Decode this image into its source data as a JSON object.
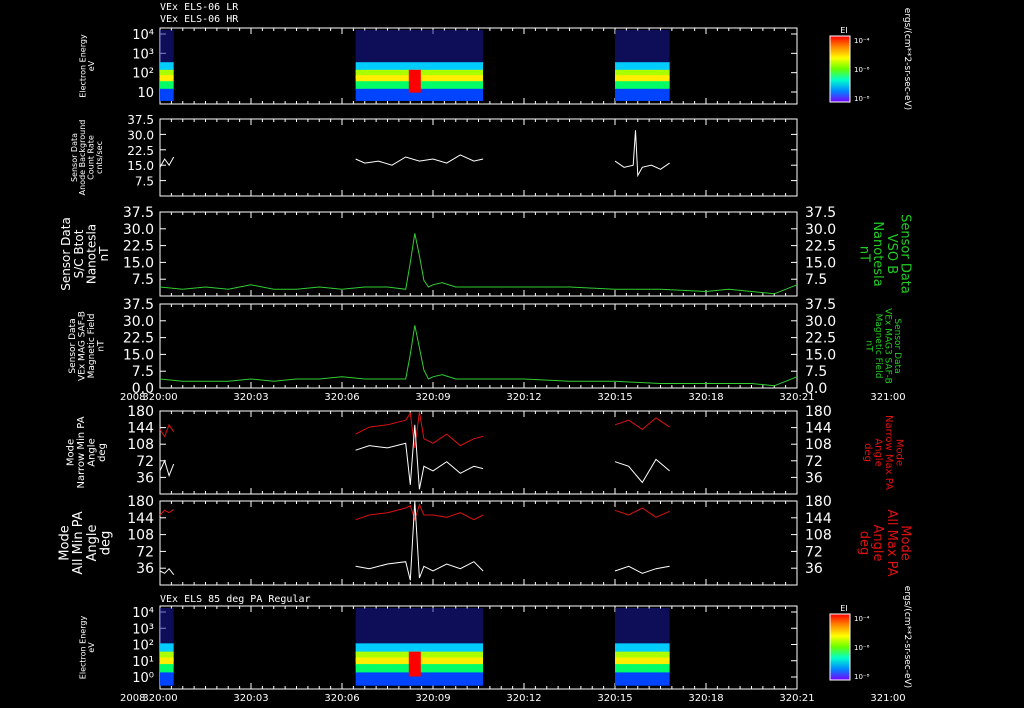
{
  "titles": {
    "top_line1": "VEx ELS-06 LR",
    "top_line2": "VEx ELS-06 HR",
    "bottom": "VEx ELS 85 deg PA Regular"
  },
  "colors": {
    "background": "#000000",
    "axis": "#ffffff",
    "trace_white": "#ffffff",
    "trace_green": "#33cc33",
    "trace_red": "#dd1111",
    "label_green": "#22cc22",
    "label_red": "#dd1111"
  },
  "time_axis": {
    "ticks": [
      "320:00",
      "320:03",
      "320:06",
      "320:09",
      "320:12",
      "320:15",
      "320:18",
      "320:21",
      "321:00"
    ],
    "year": "2008"
  },
  "chart_data": [
    {
      "type": "heatmap",
      "name_left": [
        "Electron Energy",
        "eV"
      ],
      "y_ticks": [
        "10⁴",
        "10³",
        "10²",
        "10"
      ],
      "colorbar_label": "EI",
      "colorbar_ticks": [
        "10⁻⁴",
        "10⁻⁶",
        "10⁻⁸"
      ],
      "colorbar_units": "ergs/(cm**2-sr-sec-eV)",
      "data_intervals": [
        [
          0.0,
          0.3
        ],
        [
          4.3,
          7.1
        ],
        [
          10.0,
          11.2
        ]
      ]
    },
    {
      "type": "line",
      "name_left": [
        "Sensor Data",
        "Anode Background",
        "Count Rate",
        "cnts/sec"
      ],
      "y_ticks": [
        "37.5",
        "30.0",
        "22.5",
        "15.0",
        "7.5"
      ],
      "ylim": [
        0,
        37.5
      ],
      "series": [
        {
          "x": [
            0.0,
            0.1,
            0.2,
            0.3
          ],
          "values": [
            14,
            18,
            15,
            19
          ]
        },
        {
          "x": [
            4.3,
            4.5,
            4.8,
            5.1,
            5.4,
            5.7,
            6.0,
            6.3,
            6.6,
            6.9,
            7.1
          ],
          "values": [
            18,
            16,
            17,
            15,
            19,
            17,
            18,
            16,
            20,
            17,
            18
          ]
        },
        {
          "x": [
            10.0,
            10.2,
            10.4,
            10.45,
            10.5,
            10.6,
            10.8,
            11.0,
            11.2
          ],
          "values": [
            17,
            14,
            15,
            32,
            10,
            14,
            15,
            13,
            16
          ]
        }
      ]
    },
    {
      "type": "line",
      "name_left": [
        "Sensor Data",
        "S/C Btot",
        "Nanotesla",
        "nT"
      ],
      "name_right": [
        "Sensor Data",
        "VSO B",
        "Nanotesla",
        "nT"
      ],
      "y_ticks": [
        "37.5",
        "30.0",
        "22.5",
        "15.0",
        "7.5"
      ],
      "ylim": [
        0,
        37.5
      ],
      "x": [
        0.0,
        0.5,
        1.0,
        1.5,
        2.0,
        2.5,
        3.0,
        3.5,
        4.0,
        4.5,
        5.0,
        5.4,
        5.5,
        5.6,
        5.7,
        5.8,
        5.9,
        6.0,
        6.2,
        6.5,
        7.0,
        8.0,
        9.0,
        10.0,
        11.0,
        12.0,
        12.5,
        13.0,
        13.5,
        14.0
      ],
      "values": [
        4,
        3,
        4,
        3,
        5,
        3,
        3,
        4,
        3,
        4,
        4,
        3,
        15,
        28,
        18,
        7,
        4,
        5,
        6,
        4,
        4,
        4,
        4,
        3,
        3,
        2,
        3,
        2,
        1,
        5
      ]
    },
    {
      "type": "line",
      "name_left": [
        "Sensor Data",
        "VEx MAG SAF-B",
        "Magnetic Field",
        "nT"
      ],
      "name_right": [
        "Sensor Data",
        "VEx MAG3 SAF-B",
        "Magnetic Field",
        "nT"
      ],
      "y_ticks": [
        "37.5",
        "30.0",
        "22.5",
        "15.0",
        "7.5",
        "0.0"
      ],
      "ylim": [
        0,
        37.5
      ],
      "x": [
        0.0,
        0.5,
        1.0,
        1.5,
        2.0,
        2.5,
        3.0,
        3.5,
        4.0,
        4.5,
        5.0,
        5.4,
        5.5,
        5.6,
        5.7,
        5.8,
        5.9,
        6.0,
        6.2,
        6.5,
        7.0,
        8.0,
        9.0,
        10.0,
        11.0,
        12.0,
        12.5,
        13.0,
        13.5,
        14.0
      ],
      "values": [
        4,
        3,
        3,
        3,
        4,
        3,
        4,
        4,
        5,
        4,
        4,
        4,
        15,
        28,
        18,
        8,
        4,
        5,
        6,
        4,
        4,
        4,
        3,
        3,
        2,
        2,
        2,
        2,
        1,
        5
      ]
    },
    {
      "type": "line",
      "name_left": [
        "Mode",
        "Narrow Min PA",
        "Angle",
        "deg"
      ],
      "name_right": [
        "Mode",
        "Narrow Max PA",
        "Angle",
        "deg"
      ],
      "y_ticks": [
        "180",
        "144",
        "108",
        "72",
        "36"
      ],
      "ylim": [
        0,
        180
      ],
      "series": [
        {
          "color": "red",
          "x": [
            0.0,
            0.1,
            0.2,
            0.3
          ],
          "values": [
            140,
            125,
            150,
            135
          ]
        },
        {
          "color": "white",
          "x": [
            0.0,
            0.1,
            0.2,
            0.3
          ],
          "values": [
            50,
            72,
            40,
            65
          ]
        },
        {
          "color": "red",
          "x": [
            4.3,
            4.6,
            5.0,
            5.4,
            5.5,
            5.6,
            5.7,
            5.8,
            6.0,
            6.3,
            6.6,
            6.9,
            7.1
          ],
          "values": [
            130,
            145,
            150,
            160,
            175,
            100,
            178,
            120,
            110,
            130,
            105,
            120,
            125
          ]
        },
        {
          "color": "white",
          "x": [
            4.3,
            4.6,
            5.0,
            5.4,
            5.5,
            5.6,
            5.7,
            5.8,
            6.0,
            6.3,
            6.6,
            6.9,
            7.1
          ],
          "values": [
            95,
            105,
            100,
            110,
            20,
            150,
            10,
            60,
            50,
            70,
            45,
            60,
            55
          ]
        },
        {
          "color": "red",
          "x": [
            10.0,
            10.3,
            10.6,
            10.9,
            11.2
          ],
          "values": [
            150,
            160,
            140,
            165,
            145
          ]
        },
        {
          "color": "white",
          "x": [
            10.0,
            10.3,
            10.6,
            10.9,
            11.2
          ],
          "values": [
            70,
            60,
            25,
            75,
            50
          ]
        }
      ]
    },
    {
      "type": "line",
      "name_left": [
        "Mode",
        "All Min PA",
        "Angle",
        "deg"
      ],
      "name_right": [
        "Mode",
        "All Max PA",
        "Angle",
        "deg"
      ],
      "y_ticks": [
        "180",
        "144",
        "108",
        "72",
        "36"
      ],
      "ylim": [
        0,
        180
      ],
      "series": [
        {
          "color": "red",
          "x": [
            0.0,
            0.1,
            0.2,
            0.3
          ],
          "values": [
            150,
            160,
            155,
            162
          ]
        },
        {
          "color": "white",
          "x": [
            0.0,
            0.1,
            0.2,
            0.3
          ],
          "values": [
            30,
            25,
            35,
            22
          ]
        },
        {
          "color": "red",
          "x": [
            4.3,
            4.6,
            5.0,
            5.4,
            5.5,
            5.6,
            5.7,
            5.8,
            6.0,
            6.3,
            6.6,
            6.9,
            7.1
          ],
          "values": [
            140,
            150,
            155,
            165,
            170,
            140,
            172,
            150,
            150,
            145,
            155,
            140,
            150
          ]
        },
        {
          "color": "white",
          "x": [
            4.3,
            4.6,
            5.0,
            5.4,
            5.5,
            5.6,
            5.7,
            5.8,
            6.0,
            6.3,
            6.6,
            6.9,
            7.1
          ],
          "values": [
            40,
            35,
            45,
            50,
            10,
            180,
            15,
            40,
            30,
            45,
            35,
            50,
            30
          ]
        },
        {
          "color": "red",
          "x": [
            10.0,
            10.3,
            10.6,
            10.9,
            11.2
          ],
          "values": [
            160,
            150,
            165,
            145,
            158
          ]
        },
        {
          "color": "white",
          "x": [
            10.0,
            10.3,
            10.6,
            10.9,
            11.2
          ],
          "values": [
            30,
            40,
            25,
            35,
            40
          ]
        }
      ]
    },
    {
      "type": "heatmap",
      "name_left": [
        "Electron Energy",
        "eV"
      ],
      "y_ticks": [
        "10⁴",
        "10³",
        "10²",
        "10¹",
        "10⁰"
      ],
      "colorbar_label": "EI",
      "colorbar_ticks": [
        "10⁻⁴",
        "10⁻⁶",
        "10⁻⁸"
      ],
      "colorbar_units": "ergs/(cm**2-sr-sec-eV)",
      "data_intervals": [
        [
          0.0,
          0.3
        ],
        [
          4.3,
          7.1
        ],
        [
          10.0,
          11.2
        ]
      ]
    }
  ]
}
